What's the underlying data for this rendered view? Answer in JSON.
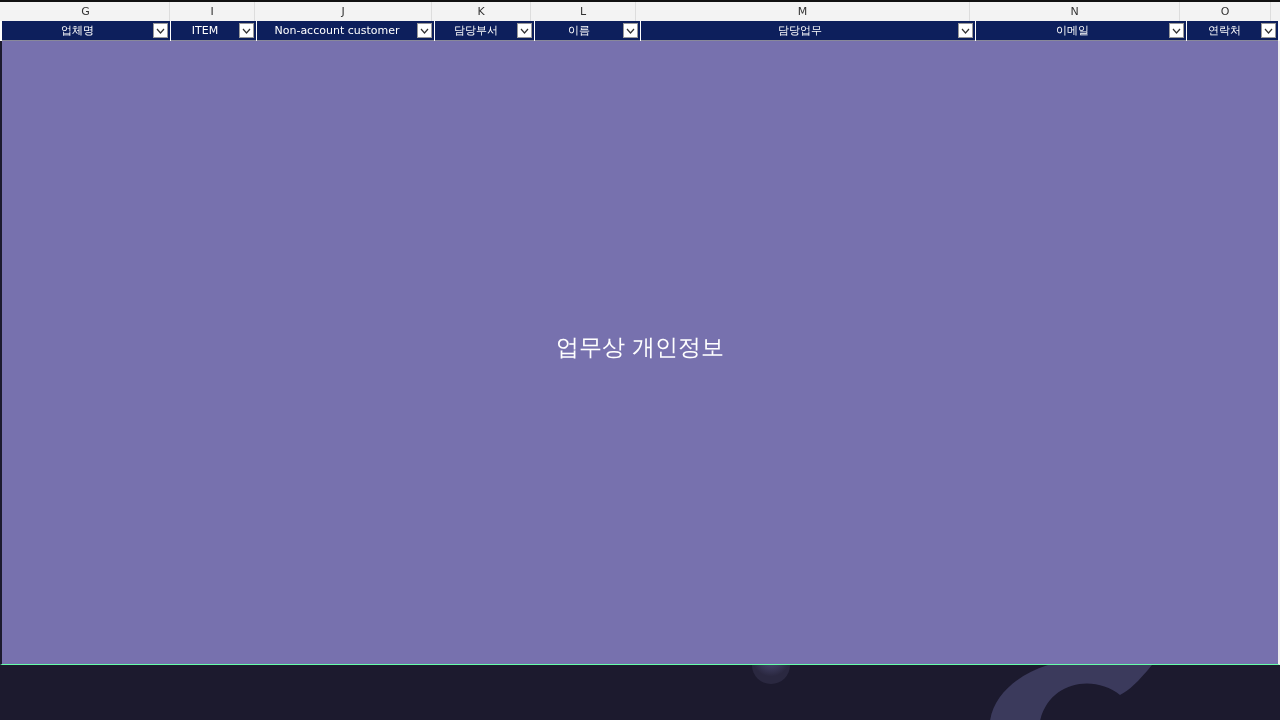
{
  "sheet": {
    "columns": [
      {
        "letter": "G",
        "header": "업체명"
      },
      {
        "letter": "I",
        "header": "ITEM"
      },
      {
        "letter": "J",
        "header": "Non-account customer"
      },
      {
        "letter": "K",
        "header": "담당부서"
      },
      {
        "letter": "L",
        "header": "이름"
      },
      {
        "letter": "M",
        "header": "담당업무"
      },
      {
        "letter": "N",
        "header": "이메일"
      },
      {
        "letter": "O",
        "header": "연락처"
      }
    ]
  },
  "overlay": {
    "caption": "업무상 개인정보"
  }
}
